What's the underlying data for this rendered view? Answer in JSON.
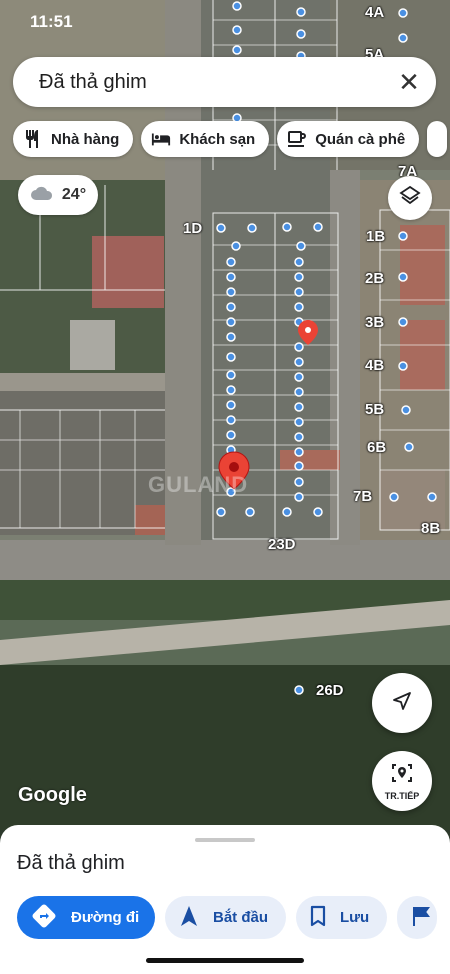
{
  "status_bar": {
    "time": "11:51"
  },
  "search": {
    "value": "Đã thả ghim",
    "close_icon": "close-icon"
  },
  "chips": [
    {
      "label": "Nhà hàng",
      "icon": "restaurant-icon"
    },
    {
      "label": "Khách sạn",
      "icon": "hotel-icon"
    },
    {
      "label": "Quán cà phê",
      "icon": "coffee-icon"
    }
  ],
  "weather": {
    "temp": "24°",
    "icon": "cloudy-icon"
  },
  "map": {
    "labels": {
      "l1D": "1D",
      "l1B": "1B",
      "l2B": "2B",
      "l3B": "3B",
      "l4B": "4B",
      "l5B": "5B",
      "l6B": "6B",
      "l7B": "7B",
      "l8B": "8B",
      "l23D": "23D",
      "l26D": "26D",
      "l4A": "4A",
      "l5A": "5A",
      "l7A": "7A"
    },
    "watermark": "GULAND",
    "attribution": "Google"
  },
  "buttons": {
    "directions_fab_icon": "navigation-icon",
    "street_view_label": "TR.TIẾP"
  },
  "sheet": {
    "title": "Đã thả ghim",
    "actions": [
      {
        "label": "Đường đi",
        "icon": "directions-icon"
      },
      {
        "label": "Bắt đầu",
        "icon": "navigation-arrow-icon"
      },
      {
        "label": "Lưu",
        "icon": "bookmark-icon"
      }
    ],
    "cut_action_icon": "flag-icon"
  },
  "colors": {
    "accent": "#1a73e8",
    "pin": "#ea4335",
    "poi_dot": "#4a90e2"
  }
}
